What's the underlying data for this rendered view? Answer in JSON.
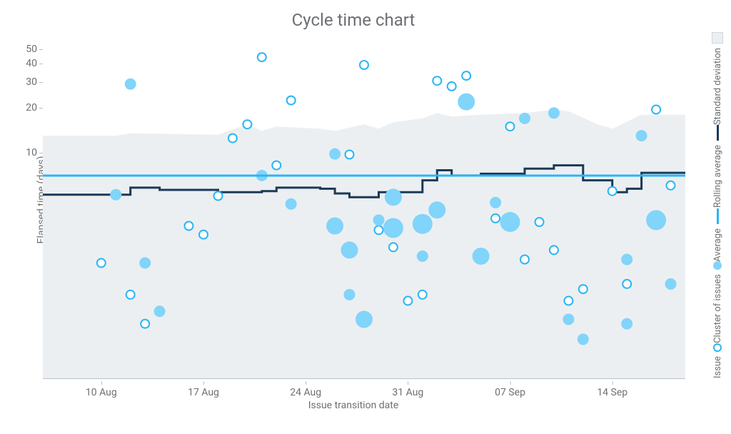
{
  "title": "Cycle time chart",
  "ylabel": "Elapsed time (days)",
  "xlabel": "Issue transition date",
  "legend": {
    "issue": "Issue",
    "cluster": "Cluster of issues",
    "average": "Average",
    "rolling": "Rolling average",
    "stddev": "Standard deviation"
  },
  "colors": {
    "average": "#29B6F6",
    "rolling": "#1b3a57",
    "cluster": "#81D4FA",
    "stddev": "#eceff1"
  },
  "chart_data": {
    "type": "scatter",
    "title": "Cycle time chart",
    "xlabel": "Issue transition date",
    "ylabel": "Elapsed time (days)",
    "legend_position": "right",
    "grid": false,
    "y_scale": "log",
    "y_ticks": [
      10,
      20,
      30,
      40,
      50
    ],
    "y_range": [
      0.3,
      55
    ],
    "x_ticks": [
      "10 Aug",
      "17 Aug",
      "24 Aug",
      "31 Aug",
      "07 Sep",
      "14 Sep"
    ],
    "x_range": [
      "06 Aug",
      "19 Sep"
    ],
    "average": 7,
    "rolling_average": [
      {
        "x": "06 Aug",
        "y": 5.2
      },
      {
        "x": "11 Aug",
        "y": 5.2
      },
      {
        "x": "12 Aug",
        "y": 5.8
      },
      {
        "x": "14 Aug",
        "y": 5.6
      },
      {
        "x": "18 Aug",
        "y": 5.4
      },
      {
        "x": "21 Aug",
        "y": 5.5
      },
      {
        "x": "22 Aug",
        "y": 5.8
      },
      {
        "x": "25 Aug",
        "y": 5.7
      },
      {
        "x": "26 Aug",
        "y": 5.3
      },
      {
        "x": "27 Aug",
        "y": 5.0
      },
      {
        "x": "29 Aug",
        "y": 5.4
      },
      {
        "x": "30 Aug",
        "y": 5.4
      },
      {
        "x": "01 Sep",
        "y": 6.5
      },
      {
        "x": "02 Sep",
        "y": 7.6
      },
      {
        "x": "03 Sep",
        "y": 7.0
      },
      {
        "x": "05 Sep",
        "y": 7.2
      },
      {
        "x": "08 Sep",
        "y": 7.8
      },
      {
        "x": "10 Sep",
        "y": 8.2
      },
      {
        "x": "11 Sep",
        "y": 8.2
      },
      {
        "x": "12 Sep",
        "y": 6.5
      },
      {
        "x": "14 Sep",
        "y": 5.4
      },
      {
        "x": "15 Sep",
        "y": 5.7
      },
      {
        "x": "16 Sep",
        "y": 7.3
      },
      {
        "x": "19 Sep",
        "y": 7.3
      }
    ],
    "stddev_upper": [
      {
        "x": "06 Aug",
        "y": 13.0
      },
      {
        "x": "11 Aug",
        "y": 13.0
      },
      {
        "x": "12 Aug",
        "y": 13.5
      },
      {
        "x": "18 Aug",
        "y": 13.2
      },
      {
        "x": "20 Aug",
        "y": 15.5
      },
      {
        "x": "21 Aug",
        "y": 14.0
      },
      {
        "x": "22 Aug",
        "y": 15.0
      },
      {
        "x": "25 Aug",
        "y": 14.5
      },
      {
        "x": "26 Aug",
        "y": 14.0
      },
      {
        "x": "28 Aug",
        "y": 15.5
      },
      {
        "x": "29 Aug",
        "y": 14.5
      },
      {
        "x": "30 Aug",
        "y": 16.0
      },
      {
        "x": "01 Sep",
        "y": 17.0
      },
      {
        "x": "02 Sep",
        "y": 18.5
      },
      {
        "x": "03 Sep",
        "y": 17.5
      },
      {
        "x": "05 Sep",
        "y": 18.0
      },
      {
        "x": "08 Sep",
        "y": 18.5
      },
      {
        "x": "10 Sep",
        "y": 19.5
      },
      {
        "x": "11 Sep",
        "y": 19.0
      },
      {
        "x": "13 Sep",
        "y": 15.5
      },
      {
        "x": "14 Sep",
        "y": 14.5
      },
      {
        "x": "16 Sep",
        "y": 18.0
      },
      {
        "x": "19 Sep",
        "y": 18.0
      }
    ],
    "series": [
      {
        "name": "Issue",
        "kind": "open",
        "points": [
          {
            "x": "10 Aug",
            "y": 1.8
          },
          {
            "x": "12 Aug",
            "y": 1.1
          },
          {
            "x": "13 Aug",
            "y": 0.7
          },
          {
            "x": "16 Aug",
            "y": 3.2
          },
          {
            "x": "17 Aug",
            "y": 2.8
          },
          {
            "x": "18 Aug",
            "y": 5.1
          },
          {
            "x": "19 Aug",
            "y": 12.5
          },
          {
            "x": "20 Aug",
            "y": 15.5
          },
          {
            "x": "21 Aug",
            "y": 44
          },
          {
            "x": "22 Aug",
            "y": 8.2
          },
          {
            "x": "23 Aug",
            "y": 22.5
          },
          {
            "x": "26 Aug",
            "y": 3.3
          },
          {
            "x": "27 Aug",
            "y": 9.7
          },
          {
            "x": "28 Aug",
            "y": 39
          },
          {
            "x": "29 Aug",
            "y": 3.0
          },
          {
            "x": "30 Aug",
            "y": 2.3
          },
          {
            "x": "31 Aug",
            "y": 1.0
          },
          {
            "x": "01 Sep",
            "y": 1.1
          },
          {
            "x": "02 Sep",
            "y": 30.5
          },
          {
            "x": "03 Sep",
            "y": 28
          },
          {
            "x": "04 Sep",
            "y": 33
          },
          {
            "x": "06 Sep",
            "y": 3.6
          },
          {
            "x": "07 Sep",
            "y": 15
          },
          {
            "x": "08 Sep",
            "y": 1.9
          },
          {
            "x": "09 Sep",
            "y": 3.4
          },
          {
            "x": "10 Sep",
            "y": 2.2
          },
          {
            "x": "11 Sep",
            "y": 1.0
          },
          {
            "x": "12 Sep",
            "y": 1.2
          },
          {
            "x": "14 Sep",
            "y": 5.5
          },
          {
            "x": "15 Sep",
            "y": 1.3
          },
          {
            "x": "17 Sep",
            "y": 19.5
          },
          {
            "x": "18 Sep",
            "y": 6.0
          }
        ]
      },
      {
        "name": "Cluster of issues",
        "kind": "filled",
        "points": [
          {
            "x": "12 Aug",
            "y": 29,
            "size": 8
          },
          {
            "x": "11 Aug",
            "y": 5.2,
            "size": 8
          },
          {
            "x": "13 Aug",
            "y": 1.8,
            "size": 8
          },
          {
            "x": "14 Aug",
            "y": 0.85,
            "size": 8
          },
          {
            "x": "21 Aug",
            "y": 7.0,
            "size": 8
          },
          {
            "x": "23 Aug",
            "y": 4.5,
            "size": 8
          },
          {
            "x": "26 Aug",
            "y": 9.8,
            "size": 8
          },
          {
            "x": "26 Aug",
            "y": 3.2,
            "size": 12
          },
          {
            "x": "27 Aug",
            "y": 2.2,
            "size": 12
          },
          {
            "x": "27 Aug",
            "y": 1.1,
            "size": 8
          },
          {
            "x": "28 Aug",
            "y": 0.75,
            "size": 12
          },
          {
            "x": "29 Aug",
            "y": 3.5,
            "size": 8
          },
          {
            "x": "30 Aug",
            "y": 3.1,
            "size": 14
          },
          {
            "x": "30 Aug",
            "y": 5.0,
            "size": 12
          },
          {
            "x": "01 Sep",
            "y": 3.3,
            "size": 14
          },
          {
            "x": "01 Sep",
            "y": 2.0,
            "size": 8
          },
          {
            "x": "02 Sep",
            "y": 4.1,
            "size": 12
          },
          {
            "x": "04 Sep",
            "y": 22,
            "size": 12
          },
          {
            "x": "05 Sep",
            "y": 2.0,
            "size": 12
          },
          {
            "x": "06 Sep",
            "y": 4.6,
            "size": 8
          },
          {
            "x": "07 Sep",
            "y": 3.4,
            "size": 14
          },
          {
            "x": "08 Sep",
            "y": 17,
            "size": 8
          },
          {
            "x": "10 Sep",
            "y": 18.5,
            "size": 8
          },
          {
            "x": "11 Sep",
            "y": 0.75,
            "size": 8
          },
          {
            "x": "12 Sep",
            "y": 0.55,
            "size": 8
          },
          {
            "x": "15 Sep",
            "y": 1.9,
            "size": 8
          },
          {
            "x": "15 Sep",
            "y": 0.7,
            "size": 8
          },
          {
            "x": "16 Sep",
            "y": 13,
            "size": 8
          },
          {
            "x": "17 Sep",
            "y": 3.5,
            "size": 14
          },
          {
            "x": "18 Sep",
            "y": 1.3,
            "size": 8
          }
        ]
      }
    ]
  }
}
